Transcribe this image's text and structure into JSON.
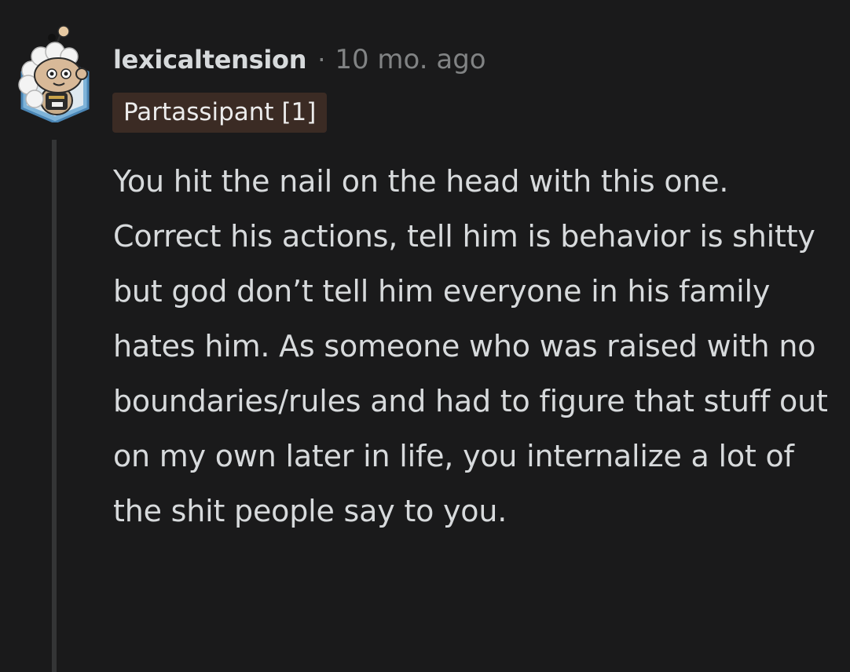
{
  "comment": {
    "username": "lexicaltension",
    "separator": "·",
    "time": "10 mo. ago",
    "flair": "Partassipant [1]",
    "body": "You hit the nail on the head with this one. Correct his actions, tell him is behavior is shitty but god don’t tell him everyone in his family hates him. As someone who was raised with no boundaries/rules and had to figure that stuff out on my own later in life, you internalize a lot of the shit people say to you.",
    "avatar_icon": "snoo-avatar-icon"
  },
  "colors": {
    "background": "#1a1a1b",
    "text": "#d7dadc",
    "meta": "#818384",
    "flair_bg": "#3b2b24",
    "thread_line": "#343536"
  }
}
